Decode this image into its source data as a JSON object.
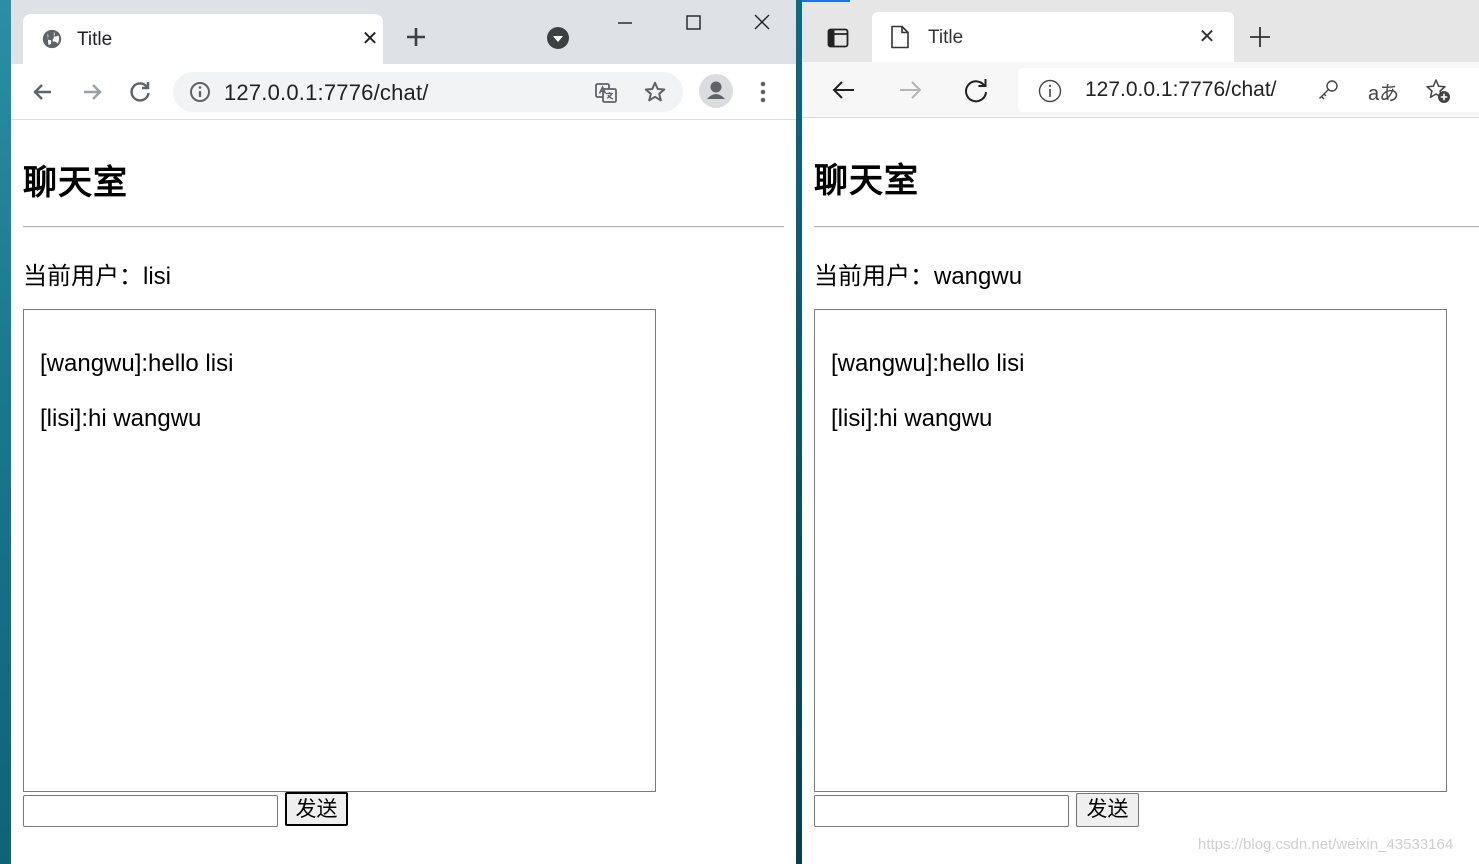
{
  "chrome": {
    "tab_title": "Title",
    "url": "127.0.0.1:7776/chat/",
    "page": {
      "title": "聊天室",
      "current_user": "当前用户：lisi",
      "messages": [
        "[wangwu]:hello lisi",
        "[lisi]:hi wangwu"
      ],
      "input_value": "",
      "send_label": "发送"
    }
  },
  "edge": {
    "tab_title": "Title",
    "url": "127.0.0.1:7776/chat/",
    "read_aloud": "aあ",
    "page": {
      "title": "聊天室",
      "current_user": "当前用户：wangwu",
      "messages": [
        "[wangwu]:hello lisi",
        "[lisi]:hi wangwu"
      ],
      "input_value": "",
      "send_label": "发送"
    }
  },
  "watermark": "https://blog.csdn.net/weixin_43533164",
  "icons": {
    "chrome_tab": "globe-icon",
    "edge_tab": "page-icon"
  }
}
